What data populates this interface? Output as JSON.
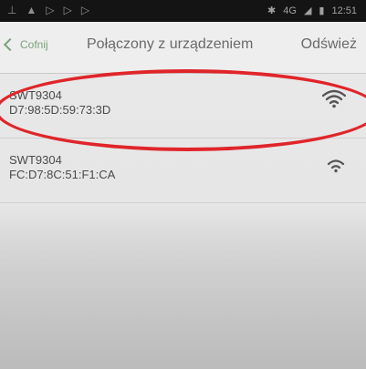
{
  "status_bar": {
    "left_icons": [
      "notification-icon",
      "alert-icon",
      "play-icon",
      "play-icon",
      "play-icon"
    ],
    "network": "4G",
    "time": "12:51"
  },
  "action_bar": {
    "back_label": "Cofnij",
    "title": "Połączony z urządzeniem",
    "refresh_label": "Odśwież"
  },
  "devices": [
    {
      "name": "SWT9304",
      "mac": "D7:98:5D:59:73:3D"
    },
    {
      "name": "SWT9304",
      "mac": "FC:D7:8C:51:F1:CA"
    }
  ],
  "colors": {
    "highlight": "#e0252a",
    "back_accent": "#7aa37a"
  }
}
